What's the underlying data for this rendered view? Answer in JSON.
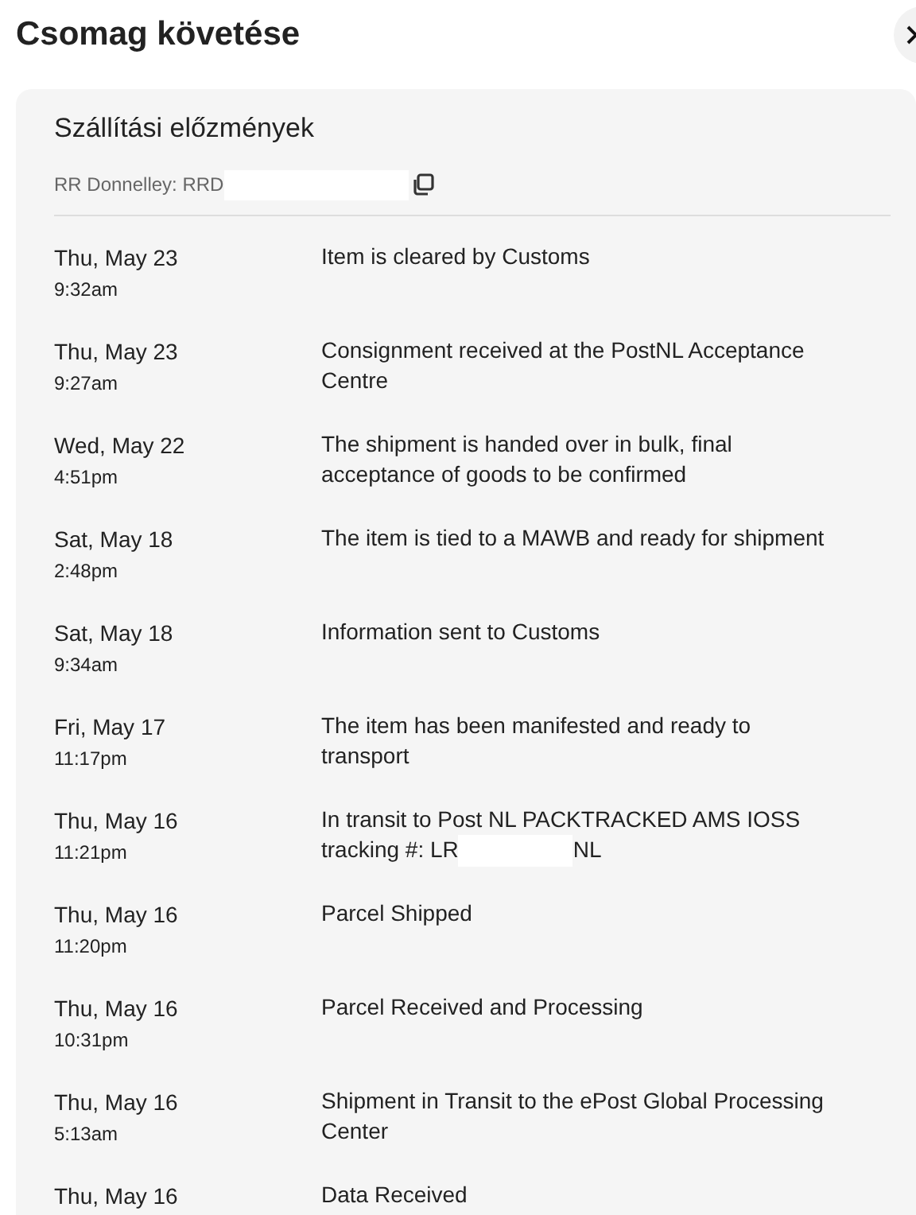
{
  "title": "Csomag követése",
  "card": {
    "heading": "Szállítási előzmények",
    "carrier": "RR Donnelley: RRD",
    "carrier_redacted": true
  },
  "events": [
    {
      "date": "Thu, May 23",
      "time": "9:32am",
      "description": [
        "Item is cleared by Customs"
      ]
    },
    {
      "date": "Thu, May 23",
      "time": "9:27am",
      "description": [
        "Consignment received at the PostNL Acceptance Centre"
      ]
    },
    {
      "date": "Wed, May 22",
      "time": "4:51pm",
      "description": [
        "The shipment is handed over in bulk, final acceptance of goods to be confirmed"
      ]
    },
    {
      "date": "Sat, May 18",
      "time": "2:48pm",
      "description": [
        "The item is tied to a MAWB and ready for shipment"
      ]
    },
    {
      "date": "Sat, May 18",
      "time": "9:34am",
      "description": [
        "Information sent to Customs"
      ]
    },
    {
      "date": "Fri, May 17",
      "time": "11:17pm",
      "description": [
        "The item has been manifested and ready to transport"
      ]
    },
    {
      "date": "Thu, May 16",
      "time": "11:21pm",
      "description": [
        "In transit to Post NL PACKTRACKED AMS IOSS tracking #: LR",
        "NL"
      ]
    },
    {
      "date": "Thu, May 16",
      "time": "11:20pm",
      "description": [
        "Parcel Shipped"
      ]
    },
    {
      "date": "Thu, May 16",
      "time": "10:31pm",
      "description": [
        "Parcel Received and Processing"
      ]
    },
    {
      "date": "Thu, May 16",
      "time": "5:13am",
      "description": [
        "Shipment in Transit to the ePost Global Processing Center"
      ]
    },
    {
      "date": "Thu, May 16",
      "description": [
        "Data Received"
      ]
    }
  ]
}
